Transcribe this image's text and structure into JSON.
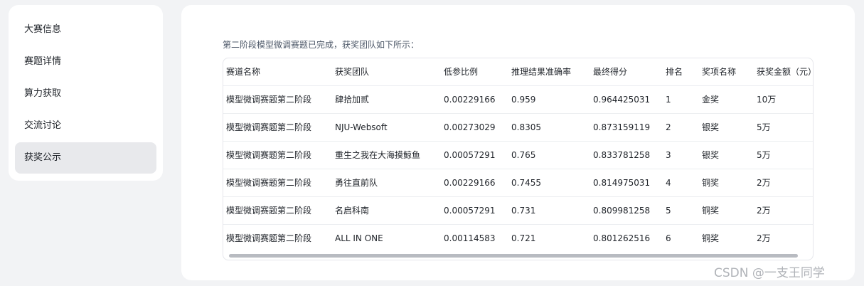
{
  "sidebar": {
    "items": [
      {
        "label": "大赛信息",
        "active": false
      },
      {
        "label": "赛题详情",
        "active": false
      },
      {
        "label": "算力获取",
        "active": false
      },
      {
        "label": "交流讨论",
        "active": false
      },
      {
        "label": "获奖公示",
        "active": true
      }
    ]
  },
  "main": {
    "intro": "第二阶段模型微调赛题已完成，获奖团队如下所示：",
    "table": {
      "columns": [
        "赛道名称",
        "获奖团队",
        "低参比例",
        "推理结果准确率",
        "最终得分",
        "排名",
        "奖项名称",
        "获奖金额（元）"
      ],
      "rows": [
        [
          "模型微调赛题第二阶段",
          "肆拾加贰",
          "0.00229166",
          "0.959",
          "0.964425031",
          "1",
          "金奖",
          "10万"
        ],
        [
          "模型微调赛题第二阶段",
          "NJU-Websoft",
          "0.00273029",
          "0.8305",
          "0.873159119",
          "2",
          "银奖",
          "5万"
        ],
        [
          "模型微调赛题第二阶段",
          "重生之我在大海摸鲸鱼",
          "0.00057291",
          "0.765",
          "0.833781258",
          "3",
          "银奖",
          "5万"
        ],
        [
          "模型微调赛题第二阶段",
          "勇往直前队",
          "0.00229166",
          "0.7455",
          "0.814975031",
          "4",
          "铜奖",
          "2万"
        ],
        [
          "模型微调赛题第二阶段",
          "名启科南",
          "0.00057291",
          "0.731",
          "0.809981258",
          "5",
          "铜奖",
          "2万"
        ],
        [
          "模型微调赛题第二阶段",
          "ALL IN ONE",
          "0.00114583",
          "0.721",
          "0.801262516",
          "6",
          "铜奖",
          "2万"
        ]
      ]
    }
  },
  "watermark": "CSDN @一支王同学"
}
